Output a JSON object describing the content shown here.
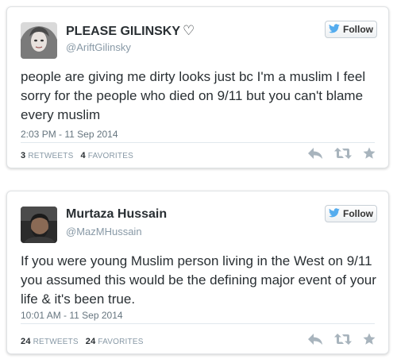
{
  "colors": {
    "twitter_blue": "#55acee",
    "text": "#292f33",
    "muted": "#8899a6",
    "action_grey": "#a8b4bd"
  },
  "tweets": [
    {
      "name": "PLEASE GILINSKY",
      "name_symbol": "♡",
      "handle": "@AriftGilinsky",
      "follow_label": "Follow",
      "text": "people are giving me dirty looks just bc I'm a muslim I feel sorry for the people who died on 9/11 but you can't blame every muslim",
      "timestamp": "2:03 PM - 11 Sep 2014",
      "retweets_count": "3",
      "retweets_label": "RETWEETS",
      "favorites_count": "4",
      "favorites_label": "FAVORITES",
      "icons": [
        "reply-icon",
        "retweet-icon",
        "favorite-icon"
      ]
    },
    {
      "name": "Murtaza Hussain",
      "handle": "@MazMHussain",
      "follow_label": "Follow",
      "text": "If you were young Muslim person living in the West on 9/11 you assumed this would be the defining major event of your life & it's been true.",
      "timestamp": "10:01 AM - 11 Sep 2014",
      "retweets_count": "24",
      "retweets_label": "RETWEETS",
      "favorites_count": "24",
      "favorites_label": "FAVORITES",
      "icons": [
        "reply-icon",
        "retweet-icon",
        "favorite-icon"
      ]
    }
  ]
}
